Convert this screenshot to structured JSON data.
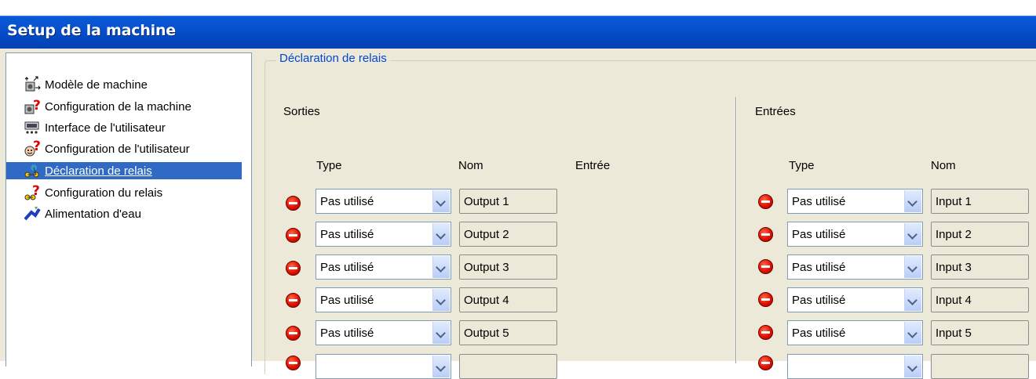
{
  "window": {
    "title": "Setup de la machine"
  },
  "tree": {
    "items": [
      {
        "label": "Modèle de machine",
        "icon": "machine-model-icon",
        "selected": false
      },
      {
        "label": "Configuration de la machine",
        "icon": "machine-config-icon",
        "selected": false
      },
      {
        "label": "Interface de l'utilisateur",
        "icon": "user-interface-icon",
        "selected": false
      },
      {
        "label": "Configuration de l'utilisateur",
        "icon": "user-config-icon",
        "selected": false
      },
      {
        "label": "Déclaration de relais",
        "icon": "relay-declaration-icon",
        "selected": true
      },
      {
        "label": "Configuration du relais",
        "icon": "relay-config-icon",
        "selected": false
      },
      {
        "label": "Alimentation d'eau",
        "icon": "water-supply-icon",
        "selected": false
      }
    ]
  },
  "group": {
    "legend": "Déclaration de relais"
  },
  "outputs": {
    "section_label": "Sorties",
    "col_type": "Type",
    "col_name": "Nom",
    "col_input": "Entrée",
    "rows": [
      {
        "type": "Pas utilisé",
        "name": "Output 1"
      },
      {
        "type": "Pas utilisé",
        "name": "Output 2"
      },
      {
        "type": "Pas utilisé",
        "name": "Output 3"
      },
      {
        "type": "Pas utilisé",
        "name": "Output 4"
      },
      {
        "type": "Pas utilisé",
        "name": "Output 5"
      }
    ]
  },
  "inputs": {
    "section_label": "Entrées",
    "col_type": "Type",
    "col_name": "Nom",
    "rows": [
      {
        "type": "Pas utilisé",
        "name": "Input 1"
      },
      {
        "type": "Pas utilisé",
        "name": "Input 2"
      },
      {
        "type": "Pas utilisé",
        "name": "Input 3"
      },
      {
        "type": "Pas utilisé",
        "name": "Input 4"
      },
      {
        "type": "Pas utilisé",
        "name": "Input 5"
      }
    ]
  },
  "colors": {
    "titlebar": "#0446c0",
    "selection": "#316ac5",
    "legend": "#0046d5",
    "stop": "#e01000",
    "dialog": "#ece9d8"
  }
}
